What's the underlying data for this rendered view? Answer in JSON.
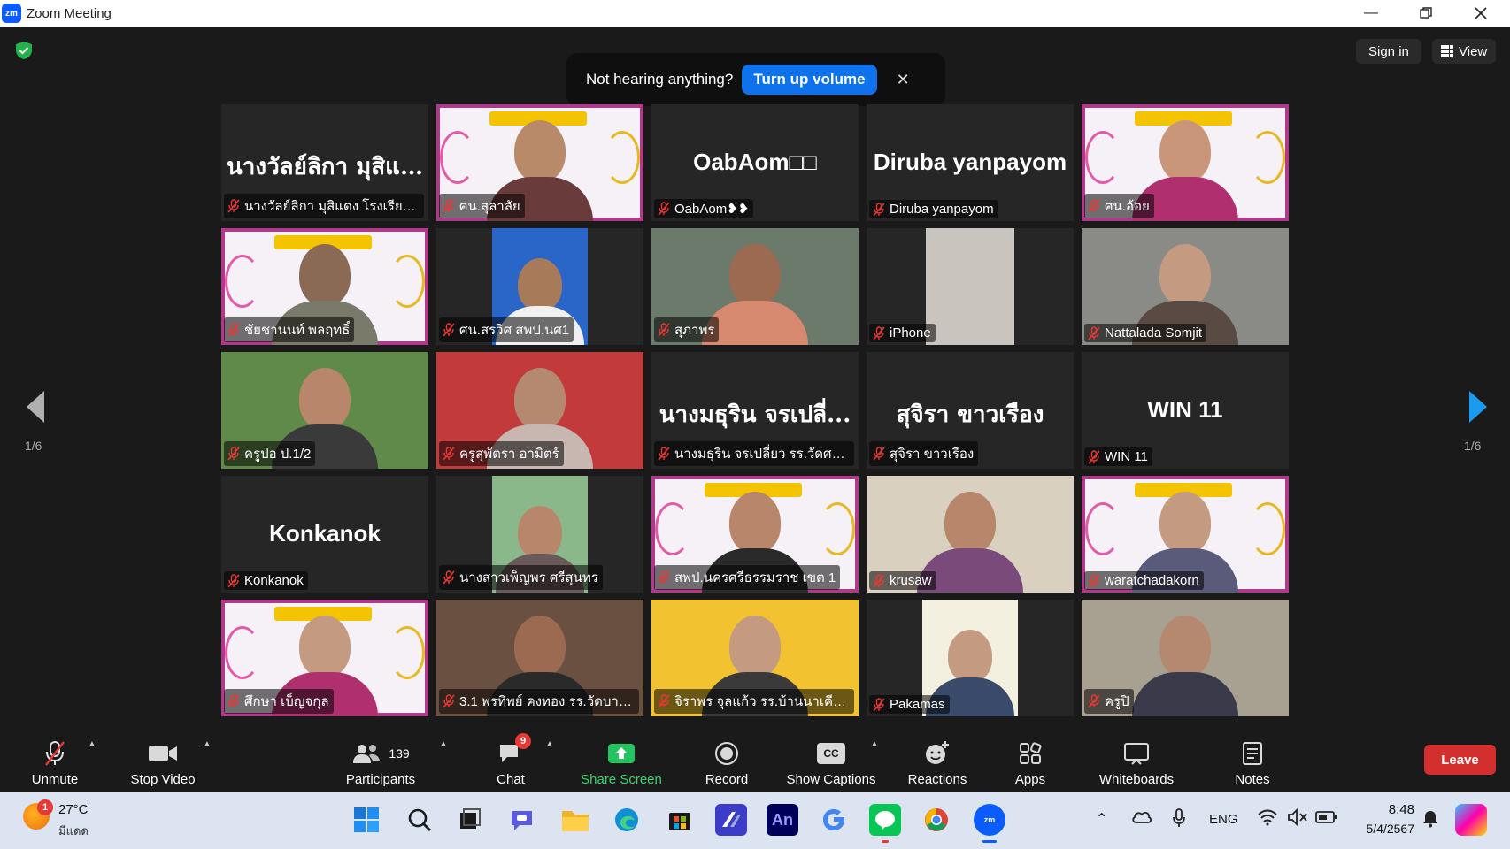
{
  "window": {
    "title": "Zoom Meeting",
    "logo": "zm"
  },
  "header": {
    "sign_in": "Sign in",
    "view": "View"
  },
  "notice": {
    "message": "Not hearing anything?",
    "action": "Turn up volume",
    "close": "✕"
  },
  "pager": {
    "left": "1/6",
    "right": "1/6"
  },
  "tiles": [
    {
      "big": "นางวัลย์ลิกา มุสิแ...",
      "label": "นางวัลย์ลิกา มุสิแดง โรงเรียนวั...",
      "kind": "name"
    },
    {
      "big": "",
      "label": "ศน.สุลาลัย",
      "kind": "slide",
      "skin": "#b98a6a",
      "cloth": "#6a3b3b"
    },
    {
      "big": "OabAom□□",
      "label": "OabAom❥❥",
      "kind": "name",
      "latin": true
    },
    {
      "big": "Diruba yanpayom",
      "label": "Diruba yanpayom",
      "kind": "name",
      "latin": true
    },
    {
      "big": "",
      "label": "ศน.อ้อย",
      "kind": "slide",
      "skin": "#c9967a",
      "cloth": "#b0306f"
    },
    {
      "big": "",
      "label": "ชัยชานนท์ พลฤทธิ์",
      "kind": "slide",
      "skin": "#8a6a55",
      "cloth": "#7a7a6a"
    },
    {
      "big": "",
      "label": "ศน.สรวิศ สพป.นศ1",
      "kind": "portrait",
      "skin": "#a77a5a",
      "cloth": "#f0f0f0",
      "bg": "#2a65c8"
    },
    {
      "big": "",
      "label": "สุภาพร",
      "kind": "cam",
      "bg": "#6b7a6a",
      "skin": "#9c6a50",
      "cloth": "#d88a70"
    },
    {
      "big": "",
      "label": "iPhone",
      "kind": "wall",
      "bg": "#c9c4bd"
    },
    {
      "big": "",
      "label": "Nattalada Somjit",
      "kind": "cam",
      "bg": "#8a8a86",
      "skin": "#c49a80",
      "cloth": "#5a4a44"
    },
    {
      "big": "",
      "label": "ครูปอ ป.1/2",
      "kind": "cam",
      "bg": "#5f8a4a",
      "skin": "#b8866a",
      "cloth": "#3a3a3a"
    },
    {
      "big": "",
      "label": "ครูสุพัตรา อามิตร์",
      "kind": "cam",
      "bg": "#c23a3a",
      "skin": "#b58870",
      "cloth": "#c7b7b0"
    },
    {
      "big": "นางมธุริน จรเปลี่...",
      "label": "นางมธุริน จรเปลี่ยว รร.วัดศรีม...",
      "kind": "name"
    },
    {
      "big": "สุจิรา ขาวเรือง",
      "label": "สุจิรา ขาวเรือง",
      "kind": "name"
    },
    {
      "big": "WIN 11",
      "label": "WIN 11",
      "kind": "name",
      "latin": true
    },
    {
      "big": "Konkanok",
      "label": "Konkanok",
      "kind": "name",
      "latin": true
    },
    {
      "big": "",
      "label": "นางสาวเพ็ญพร ศรีสุนทร",
      "kind": "portrait",
      "skin": "#b8866a",
      "cloth": "#6a5a5a",
      "bg": "#8ab88a"
    },
    {
      "big": "",
      "label": "สพป.นครศรีธรรมราช เขต 1",
      "kind": "slide",
      "skin": "#b8866a",
      "cloth": "#2a2a2a",
      "active": true
    },
    {
      "big": "",
      "label": "krusaw",
      "kind": "cam",
      "bg": "#d9d0c0",
      "skin": "#b8866a",
      "cloth": "#7a4a7a"
    },
    {
      "big": "",
      "label": "waratchadakorn",
      "kind": "slide",
      "skin": "#c49a80",
      "cloth": "#5a5a7a"
    },
    {
      "big": "",
      "label": "ศึกษา เบ็ญจกุล",
      "kind": "slide",
      "skin": "#c49a80",
      "cloth": "#b0306f"
    },
    {
      "big": "",
      "label": "3.1 พรทิพย์ คงทอง รร.วัดบางใ...",
      "kind": "cam",
      "bg": "#6a5040",
      "skin": "#9c6a50",
      "cloth": "#2a2a2a"
    },
    {
      "big": "",
      "label": "จิราพร จุลแก้ว รร.บ้านนาเคียน",
      "kind": "cam",
      "bg": "#f2c230",
      "skin": "#c49a80",
      "cloth": "#3a3a3a"
    },
    {
      "big": "",
      "label": "Pakamas",
      "kind": "portrait",
      "skin": "#c49a80",
      "cloth": "#3a4a6a",
      "bg": "#f4f0e0"
    },
    {
      "big": "",
      "label": "ครูปิ",
      "kind": "cam",
      "bg": "#a8a090",
      "skin": "#b58870",
      "cloth": "#3a3a4a"
    }
  ],
  "toolbar": {
    "unmute": "Unmute",
    "stop_video": "Stop Video",
    "participants": "Participants",
    "participants_count": "139",
    "chat": "Chat",
    "chat_badge": "9",
    "share": "Share Screen",
    "record": "Record",
    "captions": "Show Captions",
    "captions_icon": "CC",
    "reactions": "Reactions",
    "apps": "Apps",
    "whiteboards": "Whiteboards",
    "notes": "Notes",
    "leave": "Leave"
  },
  "taskbar": {
    "weather_temp": "27°C",
    "weather_desc": "มีแดด",
    "weather_badge": "1",
    "lang": "ENG",
    "time": "8:48",
    "date": "5/4/2567",
    "an_label": "An"
  },
  "colors": {
    "accent": "#0e72ed",
    "leave": "#d32f2f",
    "share": "#23c55e",
    "active_tile": "#e8e33a"
  }
}
